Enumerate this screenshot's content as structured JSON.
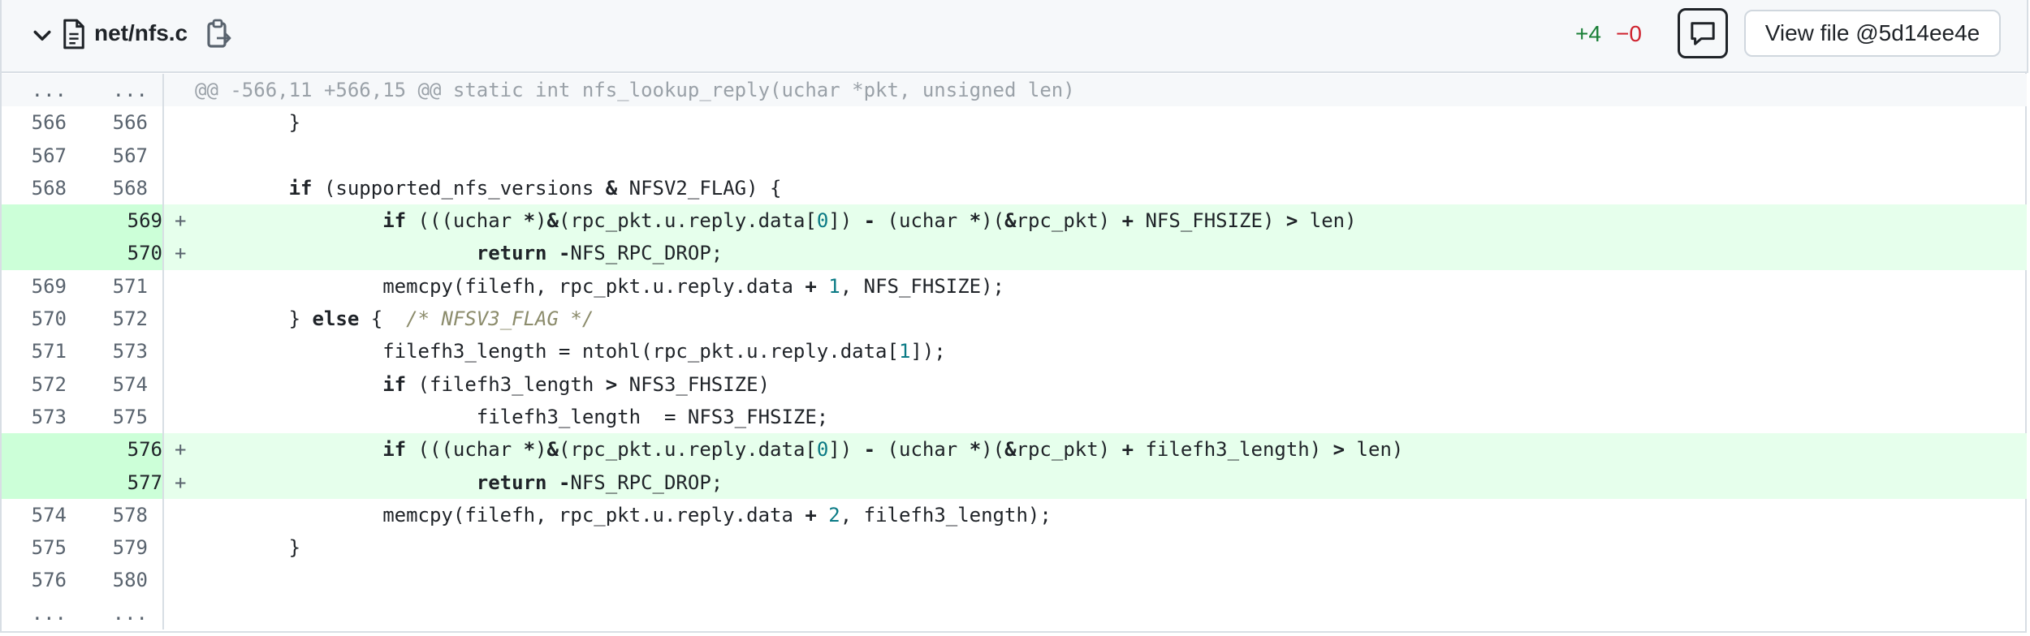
{
  "file": {
    "name": "net/nfs.c",
    "additions": "+4",
    "deletions": "−0",
    "view_button": "View file @5d14ee4e"
  },
  "icons": [
    "chevron-down-icon",
    "file-icon",
    "copy-icon",
    "comment-icon"
  ],
  "colors": {
    "add_bg": "#e6ffec",
    "add_gutter": "#ccffd8",
    "additions": "#1a7f37",
    "deletions": "#cf222e"
  },
  "hunk": {
    "old": "...",
    "new": "...",
    "text": "@@ -566,11 +566,15 @@ static int nfs_lookup_reply(uchar *pkt, unsigned len)"
  },
  "lines": [
    {
      "old": "566",
      "new": "566",
      "type": "ctx",
      "code": "        }"
    },
    {
      "old": "567",
      "new": "567",
      "type": "ctx",
      "code": ""
    },
    {
      "old": "568",
      "new": "568",
      "type": "ctx",
      "code": "        if (supported_nfs_versions & NFSV2_FLAG) {"
    },
    {
      "old": "",
      "new": "569",
      "type": "add",
      "code": "                if (((uchar *)&(rpc_pkt.u.reply.data[0]) - (uchar *)(&rpc_pkt) + NFS_FHSIZE) > len)"
    },
    {
      "old": "",
      "new": "570",
      "type": "add",
      "code": "                        return -NFS_RPC_DROP;"
    },
    {
      "old": "569",
      "new": "571",
      "type": "ctx",
      "code": "                memcpy(filefh, rpc_pkt.u.reply.data + 1, NFS_FHSIZE);"
    },
    {
      "old": "570",
      "new": "572",
      "type": "ctx",
      "code": "        } else {  /* NFSV3_FLAG */"
    },
    {
      "old": "571",
      "new": "573",
      "type": "ctx",
      "code": "                filefh3_length = ntohl(rpc_pkt.u.reply.data[1]);"
    },
    {
      "old": "572",
      "new": "574",
      "type": "ctx",
      "code": "                if (filefh3_length > NFS3_FHSIZE)"
    },
    {
      "old": "573",
      "new": "575",
      "type": "ctx",
      "code": "                        filefh3_length  = NFS3_FHSIZE;"
    },
    {
      "old": "",
      "new": "576",
      "type": "add",
      "code": "                if (((uchar *)&(rpc_pkt.u.reply.data[0]) - (uchar *)(&rpc_pkt) + filefh3_length) > len)"
    },
    {
      "old": "",
      "new": "577",
      "type": "add",
      "code": "                        return -NFS_RPC_DROP;"
    },
    {
      "old": "574",
      "new": "578",
      "type": "ctx",
      "code": "                memcpy(filefh, rpc_pkt.u.reply.data + 2, filefh3_length);"
    },
    {
      "old": "575",
      "new": "579",
      "type": "ctx",
      "code": "        }"
    },
    {
      "old": "576",
      "new": "580",
      "type": "ctx",
      "code": ""
    }
  ],
  "footer": {
    "old": "...",
    "new": "..."
  }
}
